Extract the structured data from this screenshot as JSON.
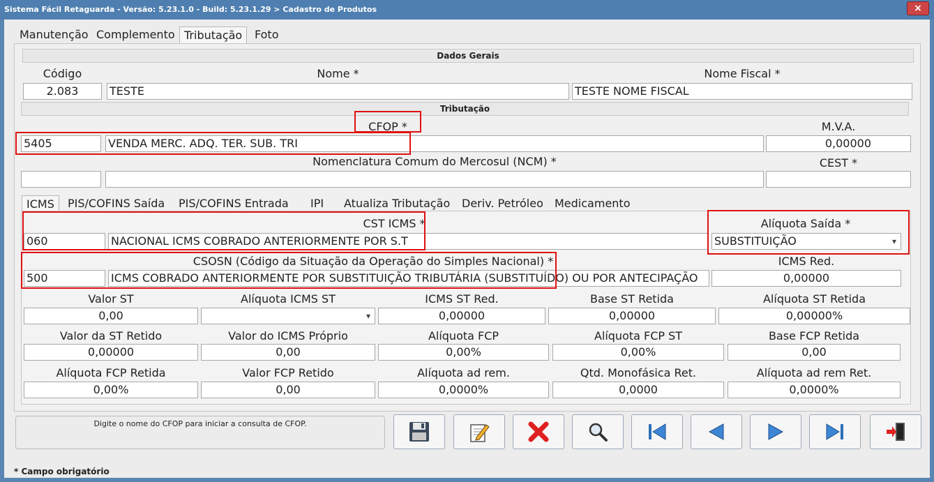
{
  "window": {
    "title": "Sistema Fácil Retaguarda - Versão: 5.23.1.0  - Build: 5.23.1.29 > Cadastro de Produtos",
    "close_label": "×"
  },
  "tabs": [
    "Manutenção",
    "Complemento",
    "Tributação",
    "Foto"
  ],
  "dados_gerais": {
    "section_title": "Dados Gerais",
    "codigo_label": "Código",
    "codigo_value": "2.083",
    "nome_label": "Nome *",
    "nome_value": "TESTE",
    "nome_fiscal_label": "Nome Fiscal *",
    "nome_fiscal_value": "TESTE NOME FISCAL"
  },
  "tributacao": {
    "section_title": "Tributação",
    "cfop_label": "CFOP *",
    "cfop_code": "5405",
    "cfop_desc": "VENDA MERC. ADQ. TER. SUB. TRI",
    "mva_label": "M.V.A.",
    "mva_value": "0,00000",
    "ncm_label": "Nomenclatura Comum do Mercosul (NCM) *",
    "ncm_code": "",
    "ncm_desc": "",
    "cest_label": "CEST *",
    "cest_value": ""
  },
  "subtabs": [
    "ICMS",
    "PIS/COFINS Saída",
    "PIS/COFINS Entrada",
    "IPI",
    "Atualiza Tributação",
    "Deriv. Petróleo",
    "Medicamento"
  ],
  "icms": {
    "cst_label": "CST ICMS *",
    "cst_code": "060",
    "cst_desc": "NACIONAL ICMS COBRADO ANTERIORMENTE POR S.T",
    "aliq_saida_label": "Alíquota Saída *",
    "aliq_saida_value": "SUBSTITUIÇÃO",
    "csosn_label": "CSOSN (Código da Situação da Operação do Simples Nacional) *",
    "csosn_code": "500",
    "csosn_desc": "ICMS COBRADO ANTERIORMENTE POR SUBSTITUIÇÃO TRIBUTÁRIA (SUBSTITUÍDO) OU POR ANTECIPAÇÃO",
    "icms_red_label": "ICMS Red.",
    "icms_red_value": "0,00000",
    "grid": [
      [
        {
          "label": "Valor ST",
          "value": "0,00"
        },
        {
          "label": "Alíquota ICMS ST",
          "value": ""
        },
        {
          "label": "ICMS ST Red.",
          "value": "0,00000"
        },
        {
          "label": "Base ST Retida",
          "value": "0,00000"
        },
        {
          "label": "Alíquota ST Retida",
          "value": "0,00000%"
        }
      ],
      [
        {
          "label": "Valor da ST Retido",
          "value": "0,00000"
        },
        {
          "label": "Valor do ICMS Próprio",
          "value": "0,00"
        },
        {
          "label": "Alíquota FCP",
          "value": "0,00%"
        },
        {
          "label": "Alíquota FCP ST",
          "value": "0,00%"
        },
        {
          "label": "Base FCP Retida",
          "value": "0,00"
        }
      ],
      [
        {
          "label": "Alíquota FCP Retida",
          "value": "0,00%"
        },
        {
          "label": "Valor FCP Retido",
          "value": "0,00"
        },
        {
          "label": "Alíquota ad rem.",
          "value": "0,0000%"
        },
        {
          "label": "Qtd. Monofásica Ret.",
          "value": "0,0000"
        },
        {
          "label": "Alíquota ad rem Ret.",
          "value": "0,0000%"
        }
      ]
    ]
  },
  "status_message": "Digite o nome do CFOP para iniciar a consulta de CFOP.",
  "toolbar": {
    "icons": [
      "save-icon",
      "edit-icon",
      "delete-icon",
      "search-icon",
      "first-record-icon",
      "previous-record-icon",
      "next-record-icon",
      "last-record-icon",
      "exit-icon"
    ]
  },
  "footer_note": "*  Campo obrigatório",
  "colors": {
    "highlight": "#e01010",
    "title_bar": "#4f7fb0"
  }
}
